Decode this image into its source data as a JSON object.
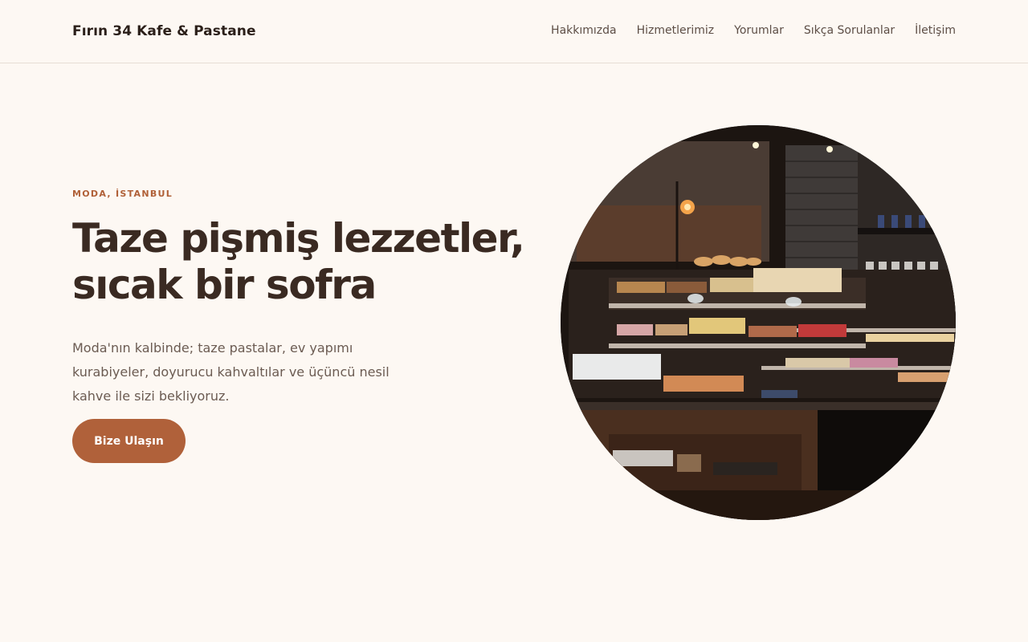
{
  "header": {
    "brand": "Fırın 34 Kafe & Pastane",
    "nav": [
      {
        "label": "Hakkımızda"
      },
      {
        "label": "Hizmetlerimiz"
      },
      {
        "label": "Yorumlar"
      },
      {
        "label": "Sıkça Sorulanlar"
      },
      {
        "label": "İletişim"
      }
    ]
  },
  "hero": {
    "eyebrow": "MODA, İSTANBUL",
    "title_line1": "Taze pişmiş lezzetler,",
    "title_line2": "sıcak bir sofra",
    "description": "Moda'nın kalbinde; taze pastalar, ev yapımı kurabiyeler, doyurucu kahvaltılar ve üçüncü nesil kahve ile sizi bekliyoruz.",
    "cta_label": "Bize Ulaşın"
  },
  "colors": {
    "background": "#fdf8f3",
    "accent": "#b0613a",
    "heading": "#3a2a22",
    "body_text": "#6b5b52"
  }
}
